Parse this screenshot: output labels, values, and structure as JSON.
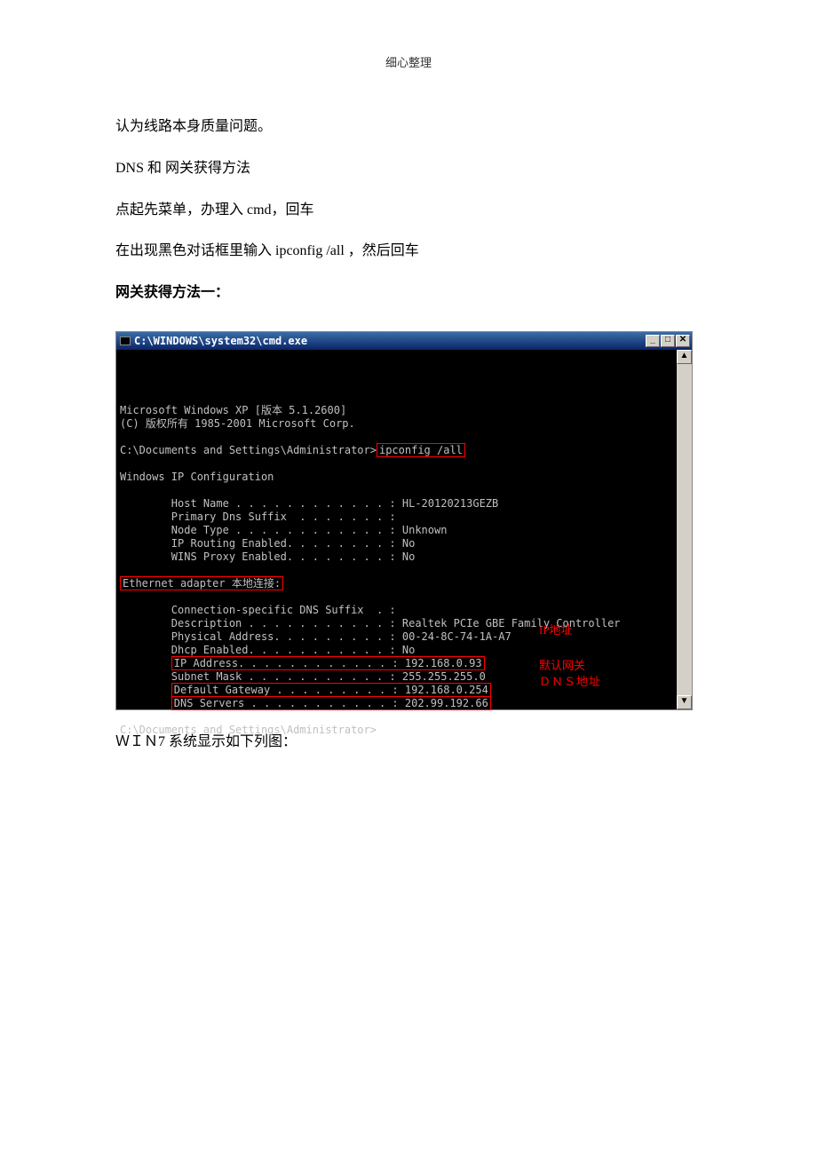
{
  "header": "细心整理",
  "para1": "认为线路本身质量问题。",
  "para2": "DNS 和 网关获得方法",
  "para3": "点起先菜单，办理入 cmd，回车",
  "para4": "在出现黑色对话框里输入 ipconfig /all ，然后回车",
  "heading1": "网关获得方法一：",
  "cmd": {
    "title": "C:\\WINDOWS\\system32\\cmd.exe",
    "line1": "Microsoft Windows XP [版本 5.1.2600]",
    "line2": "(C) 版权所有 1985-2001 Microsoft Corp.",
    "promptPath": "C:\\Documents and Settings\\Administrator>",
    "promptCmd": "ipconfig /all",
    "section1": "Windows IP Configuration",
    "hostName": "        Host Name . . . . . . . . . . . . : HL-20120213GEZB",
    "primaryDns": "        Primary Dns Suffix  . . . . . . . :",
    "nodeType": "        Node Type . . . . . . . . . . . . : Unknown",
    "ipRouting": "        IP Routing Enabled. . . . . . . . : No",
    "winsProxy": "        WINS Proxy Enabled. . . . . . . . : No",
    "adapterLine": "Ethernet adapter 本地连接:",
    "connSuffix": "        Connection-specific DNS Suffix  . :",
    "description": "        Description . . . . . . . . . . . : Realtek PCIe GBE Family Controller",
    "physAddr": "        Physical Address. . . . . . . . . : 00-24-8C-74-1A-A7",
    "dhcp": "        Dhcp Enabled. . . . . . . . . . . : No",
    "ipAddr": "        IP Address. . . . . . . . . . . . : 192.168.0.93",
    "subnet": "        Subnet Mask . . . . . . . . . . . : 255.255.255.0",
    "gateway": "        Default Gateway . . . . . . . . . : 192.168.0.254",
    "dnsServers": "        DNS Servers . . . . . . . . . . . : 202.99.192.66",
    "finalPrompt": "C:\\Documents and Settings\\Administrator>"
  },
  "annotations": {
    "ip": "IP地址",
    "gateway": "默认网关",
    "dns": "ＤＮＳ地址"
  },
  "footer": "ＷＩＮ7 系统显示如下列图："
}
